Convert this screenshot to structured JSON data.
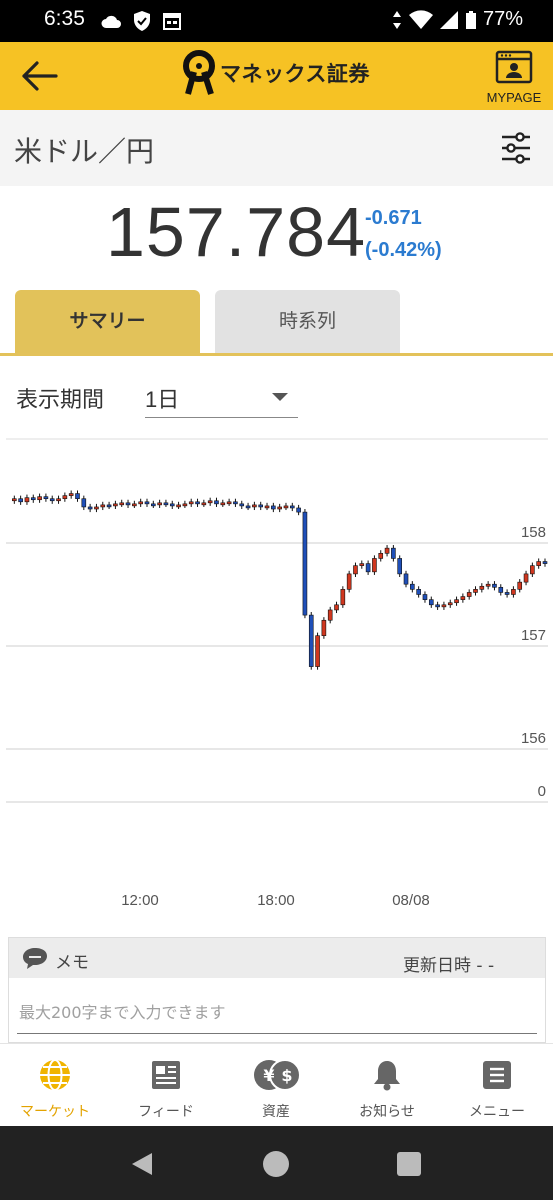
{
  "status_bar": {
    "time": "6:35",
    "battery": "77%"
  },
  "app_bar": {
    "logo_text": "マネックス証券",
    "mypage_label": "MYPAGE"
  },
  "instrument": {
    "name": "米ドル／円"
  },
  "quote": {
    "price": "157.784",
    "change": "-0.671",
    "change_pct": "(-0.42%)",
    "change_color": "#2b7bd0"
  },
  "tabs": [
    {
      "label": "サマリー",
      "active": true
    },
    {
      "label": "時系列",
      "active": false
    }
  ],
  "period": {
    "label": "表示期間",
    "selected": "1日"
  },
  "chart_data": {
    "type": "candlestick",
    "instrument": "USD/JPY",
    "x_tick_labels": [
      "12:00",
      "18:00",
      "08/08"
    ],
    "y_tick_labels": [
      "158",
      "157",
      "156",
      "0"
    ],
    "ylim": [
      155.5,
      158.6
    ],
    "up_color": "#d0371f",
    "down_color": "#1f4fb8",
    "close_series": [
      158.41,
      158.43,
      158.4,
      158.44,
      158.42,
      158.45,
      158.43,
      158.41,
      158.43,
      158.46,
      158.48,
      158.43,
      158.35,
      158.33,
      158.35,
      158.37,
      158.36,
      158.38,
      158.39,
      158.37,
      158.38,
      158.4,
      158.38,
      158.37,
      158.39,
      158.38,
      158.36,
      158.37,
      158.38,
      158.4,
      158.38,
      158.39,
      158.41,
      158.38,
      158.39,
      158.4,
      158.38,
      158.36,
      158.35,
      158.37,
      158.35,
      158.36,
      158.33,
      158.35,
      158.36,
      158.34,
      158.3,
      157.3,
      156.8,
      157.1,
      157.25,
      157.35,
      157.4,
      157.55,
      157.7,
      157.78,
      157.8,
      157.72,
      157.85,
      157.9,
      157.95,
      157.85,
      157.7,
      157.6,
      157.55,
      157.5,
      157.45,
      157.4,
      157.38,
      157.4,
      157.42,
      157.45,
      157.48,
      157.52,
      157.55,
      157.58,
      157.6,
      157.57,
      157.52,
      157.5,
      157.55,
      157.62,
      157.7,
      157.78,
      157.82,
      157.8
    ]
  },
  "memo": {
    "title": "メモ",
    "updated_label": "更新日時 - -",
    "placeholder": "最大200字まで入力できます"
  },
  "bottom_nav": [
    {
      "label": "マーケット",
      "icon": "globe-icon",
      "active": true
    },
    {
      "label": "フィード",
      "icon": "newspaper-icon",
      "active": false
    },
    {
      "label": "資産",
      "icon": "yen-dollar-coins-icon",
      "active": false
    },
    {
      "label": "お知らせ",
      "icon": "bell-icon",
      "active": false
    },
    {
      "label": "メニュー",
      "icon": "menu-list-icon",
      "active": false
    }
  ],
  "colors": {
    "accent": "#f6c224",
    "active_tab": "#e2c25a",
    "nav_active": "#e3a300"
  }
}
